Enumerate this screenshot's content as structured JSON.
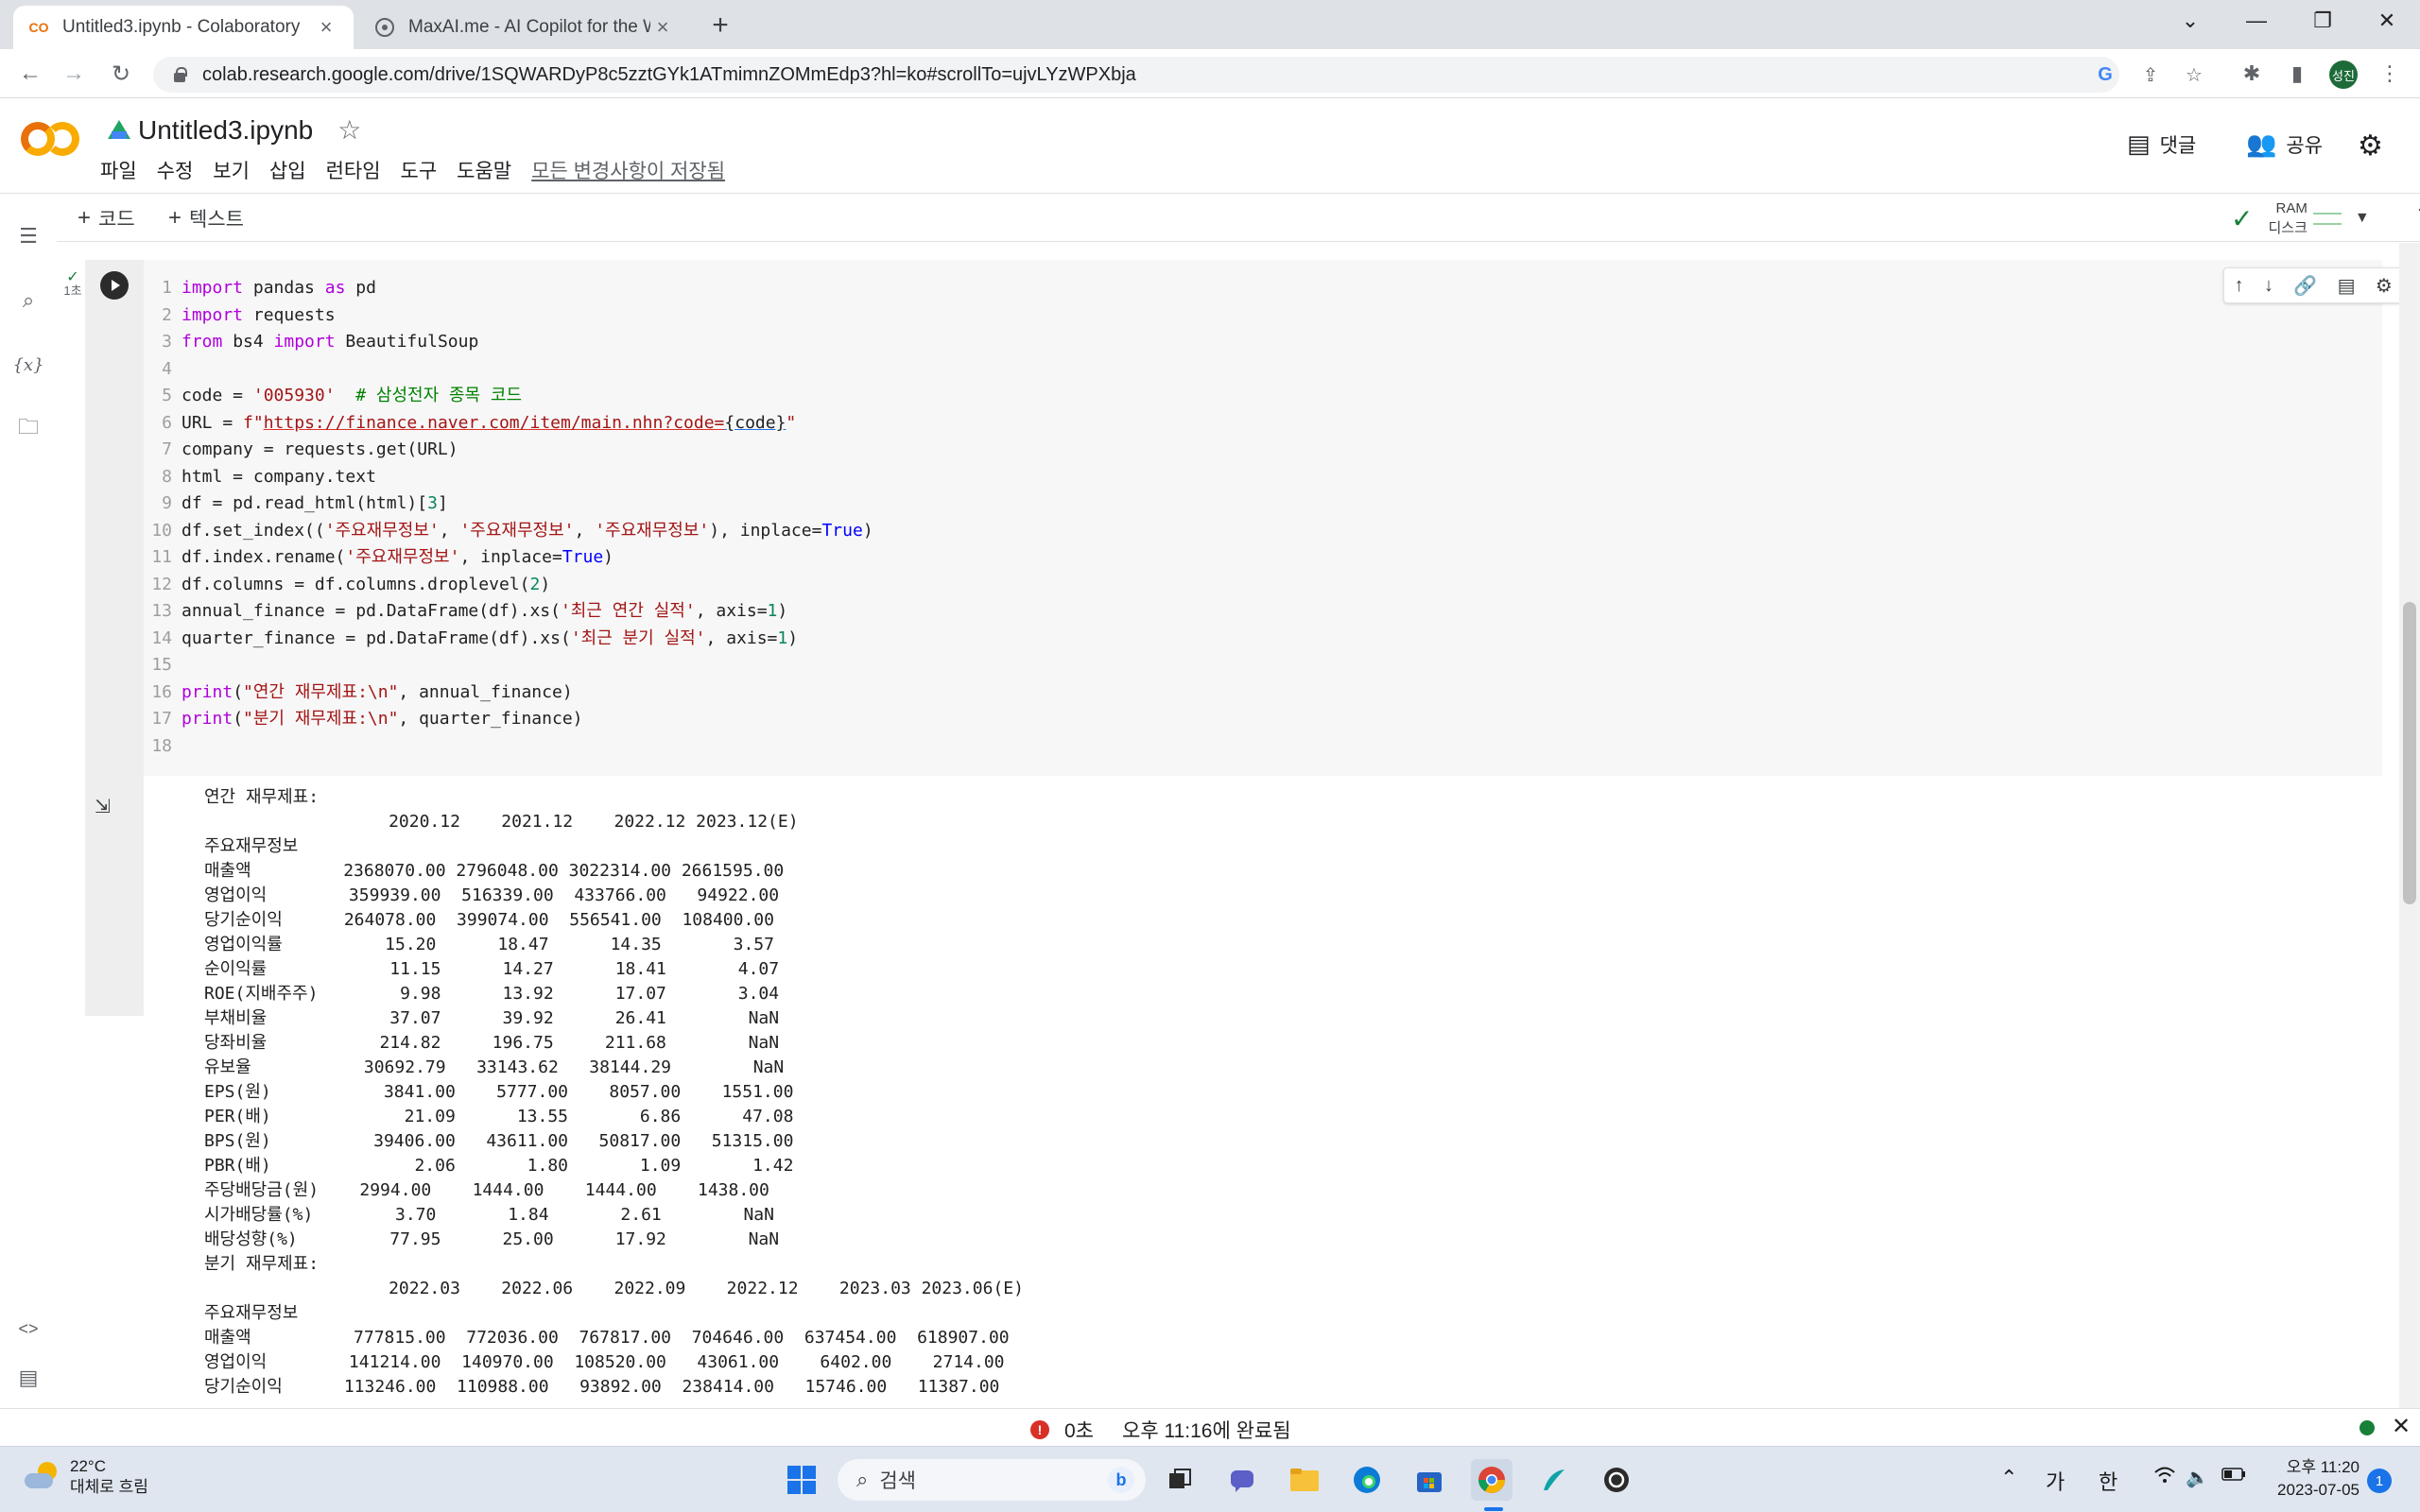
{
  "browser": {
    "tabs": [
      {
        "title": "Untitled3.ipynb - Colaboratory",
        "favicon": "CO",
        "active": true
      },
      {
        "title": "MaxAI.me - AI Copilot for the W",
        "favicon": "maxai-icon",
        "active": false
      }
    ],
    "url": "colab.research.google.com/drive/1SQWARDyP8c5zztGYk1ATmimnZOMmEdp3?hl=ko#scrollTo=ujvLYzWPXbja",
    "profile_initials": "성진"
  },
  "colab": {
    "notebook_title": "Untitled3.ipynb",
    "menu": [
      "파일",
      "수정",
      "보기",
      "삽입",
      "런타임",
      "도구",
      "도움말"
    ],
    "saved_status": "모든 변경사항이 저장됨",
    "comment_label": "댓글",
    "share_label": "공유",
    "add_code": "코드",
    "add_text": "텍스트",
    "ram_label": "RAM",
    "disk_label": "디스크",
    "cell_exec_time": "1초"
  },
  "code_lines": {
    "l1": [
      "import",
      " pandas ",
      "as",
      " pd"
    ],
    "l2": [
      "import",
      " requests"
    ],
    "l3": [
      "from",
      " bs4 ",
      "import",
      " BeautifulSoup"
    ],
    "l5": [
      "code = ",
      "'005930'",
      "  ",
      "# 삼성전자 종목 코드"
    ],
    "l6": [
      "URL = ",
      "f\"",
      "https://finance.naver.com/item/main.nhn?code=",
      "{code}",
      "\""
    ],
    "l7": "company = requests.get(URL)",
    "l8": "html = company.text",
    "l9": [
      "df = pd.read_html(html)[",
      "3",
      "]"
    ],
    "l10": [
      "df.set_index((",
      "'주요재무정보'",
      ", ",
      "'주요재무정보'",
      ", ",
      "'주요재무정보'",
      "), inplace=",
      "True",
      ")"
    ],
    "l11": [
      "df.index.rename(",
      "'주요재무정보'",
      ", inplace=",
      "True",
      ")"
    ],
    "l12": [
      "df.columns = df.columns.droplevel(",
      "2",
      ")"
    ],
    "l13": [
      "annual_finance = pd.DataFrame(df).xs(",
      "'최근 연간 실적'",
      ", axis=",
      "1",
      ")"
    ],
    "l14": [
      "quarter_finance = pd.DataFrame(df).xs(",
      "'최근 분기 실적'",
      ", axis=",
      "1",
      ")"
    ],
    "l16": [
      "print",
      "(",
      "\"연간 재무제표:\\n\"",
      ", annual_finance)"
    ],
    "l17": [
      "print",
      "(",
      "\"분기 재무제표:\\n\"",
      ", quarter_finance)"
    ]
  },
  "output": {
    "annual_heading": "연간 재무제표:",
    "annual_columns": [
      "2020.12",
      "2021.12",
      "2022.12",
      "2023.12(E)"
    ],
    "index_name": "주요재무정보",
    "annual_rows": [
      {
        "label": "매출액",
        "values": [
          "2368070.00",
          "2796048.00",
          "3022314.00",
          "2661595.00"
        ]
      },
      {
        "label": "영업이익",
        "values": [
          "359939.00",
          "516339.00",
          "433766.00",
          "94922.00"
        ]
      },
      {
        "label": "당기순이익",
        "values": [
          "264078.00",
          "399074.00",
          "556541.00",
          "108400.00"
        ]
      },
      {
        "label": "영업이익률",
        "values": [
          "15.20",
          "18.47",
          "14.35",
          "3.57"
        ]
      },
      {
        "label": "순이익률",
        "values": [
          "11.15",
          "14.27",
          "18.41",
          "4.07"
        ]
      },
      {
        "label": "ROE(지배주주)",
        "values": [
          "9.98",
          "13.92",
          "17.07",
          "3.04"
        ]
      },
      {
        "label": "부채비율",
        "values": [
          "37.07",
          "39.92",
          "26.41",
          "NaN"
        ]
      },
      {
        "label": "당좌비율",
        "values": [
          "214.82",
          "196.75",
          "211.68",
          "NaN"
        ]
      },
      {
        "label": "유보율",
        "values": [
          "30692.79",
          "33143.62",
          "38144.29",
          "NaN"
        ]
      },
      {
        "label": "EPS(원)",
        "values": [
          "3841.00",
          "5777.00",
          "8057.00",
          "1551.00"
        ]
      },
      {
        "label": "PER(배)",
        "values": [
          "21.09",
          "13.55",
          "6.86",
          "47.08"
        ]
      },
      {
        "label": "BPS(원)",
        "values": [
          "39406.00",
          "43611.00",
          "50817.00",
          "51315.00"
        ]
      },
      {
        "label": "PBR(배)",
        "values": [
          "2.06",
          "1.80",
          "1.09",
          "1.42"
        ]
      },
      {
        "label": "주당배당금(원)",
        "values": [
          "2994.00",
          "1444.00",
          "1444.00",
          "1438.00"
        ]
      },
      {
        "label": "시가배당률(%)",
        "values": [
          "3.70",
          "1.84",
          "2.61",
          "NaN"
        ]
      },
      {
        "label": "배당성향(%)",
        "values": [
          "77.95",
          "25.00",
          "17.92",
          "NaN"
        ]
      }
    ],
    "quarter_heading": "분기 재무제표:",
    "quarter_columns": [
      "2022.03",
      "2022.06",
      "2022.09",
      "2022.12",
      "2023.03",
      "2023.06(E)"
    ],
    "quarter_rows": [
      {
        "label": "매출액",
        "values": [
          "777815.00",
          "772036.00",
          "767817.00",
          "704646.00",
          "637454.00",
          "618907.00"
        ]
      },
      {
        "label": "영업이익",
        "values": [
          "141214.00",
          "140970.00",
          "108520.00",
          "43061.00",
          "6402.00",
          "2714.00"
        ]
      },
      {
        "label": "당기순이익",
        "values": [
          "113246.00",
          "110988.00",
          "93892.00",
          "238414.00",
          "15746.00",
          "11387.00"
        ]
      }
    ]
  },
  "statusbar": {
    "duration": "0초",
    "completed": "오후 11:16에 완료됨"
  },
  "taskbar": {
    "temperature": "22°C",
    "weather": "대체로 흐림",
    "search_placeholder": "검색",
    "ime_1": "가",
    "ime_2": "한",
    "time": "오후 11:20",
    "date": "2023-07-05",
    "notifications": "1"
  }
}
